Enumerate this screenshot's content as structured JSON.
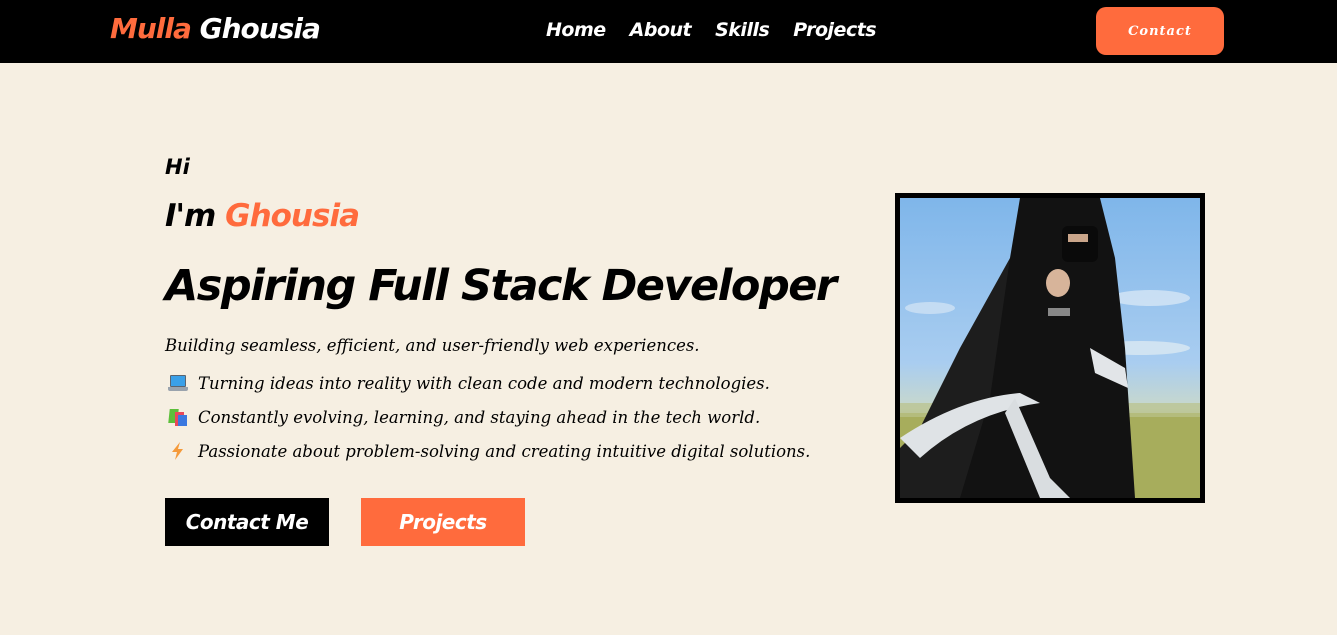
{
  "nav": {
    "logo_first": "Mulla",
    "logo_last": "Ghousia",
    "links": [
      "Home",
      "About",
      "Skills",
      "Projects"
    ],
    "contact_label": "Contact"
  },
  "hero": {
    "greeting": "Hi",
    "im_prefix": "I'm",
    "name": "Ghousia",
    "title": "Aspiring Full Stack Developer",
    "tagline": "Building seamless, efficient, and user-friendly web experiences.",
    "points": [
      {
        "icon": "laptop-icon",
        "text": "Turning ideas into reality with clean code and modern technologies."
      },
      {
        "icon": "books-icon",
        "text": "Constantly evolving, learning, and staying ahead in the tech world."
      },
      {
        "icon": "lightning-icon",
        "text": "Passionate about problem-solving and creating intuitive digital solutions."
      }
    ],
    "contact_button": "Contact Me",
    "projects_button": "Projects"
  },
  "colors": {
    "accent": "#ff6b3d",
    "background": "#f6efe2",
    "navbar": "#000000"
  }
}
